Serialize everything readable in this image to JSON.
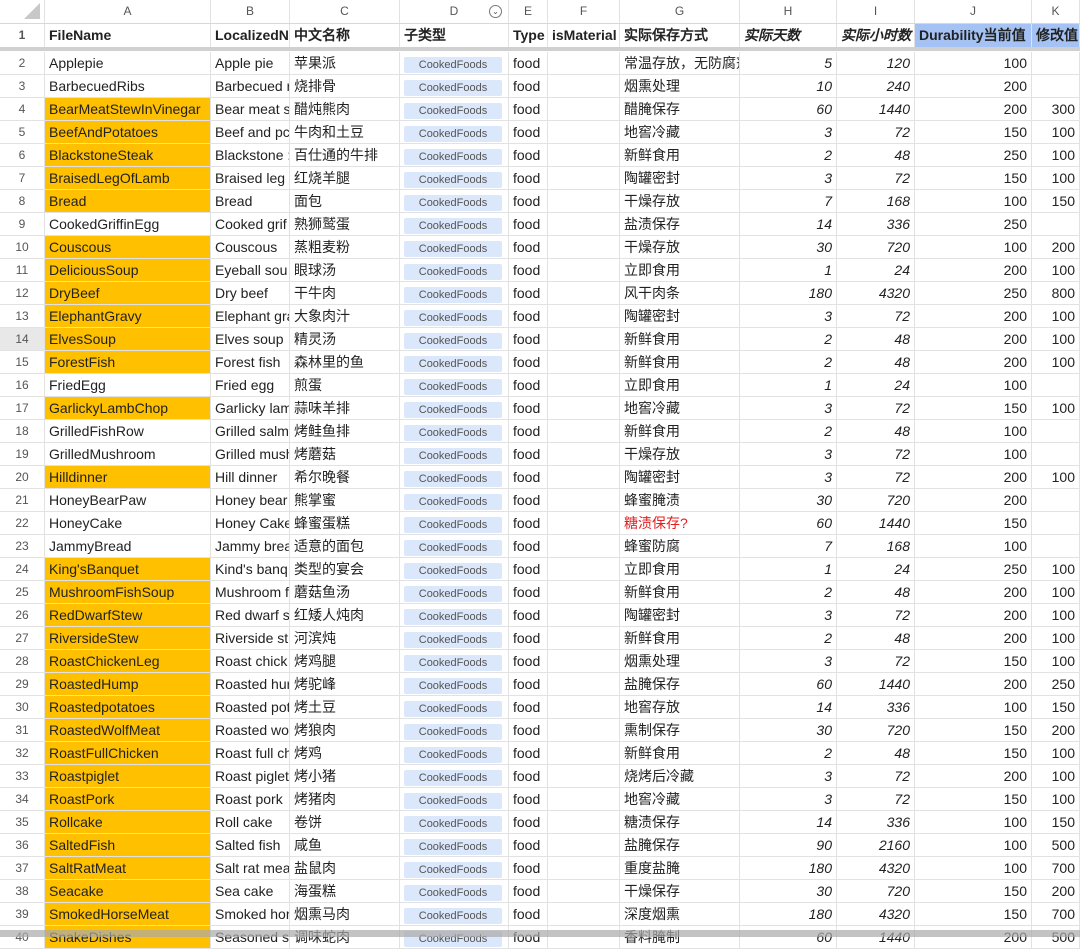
{
  "columns": [
    "A",
    "B",
    "C",
    "D",
    "E",
    "F",
    "G",
    "H",
    "I",
    "J",
    "K"
  ],
  "header": {
    "row": "1",
    "FileName": "FileName",
    "LocalizedName": "LocalizedN",
    "cn": "中文名称",
    "subtype": "子类型",
    "type": "Type",
    "isMaterial": "isMaterial",
    "storage": "实际保存方式",
    "days": "实际天数",
    "hours": "实际小时数",
    "durability": "Durability当前值",
    "modified": "修改值"
  },
  "colors": {
    "highlight": "#ffc000",
    "header_blue": "#a4c2f4",
    "chip": "#dbe7fb",
    "warn": "#e02020"
  },
  "rows": [
    {
      "n": "2",
      "a": "Applepie",
      "b": "Apple pie",
      "c": "苹果派",
      "d": "CookedFoods",
      "e": "food",
      "g": "常温存放，无防腐剂",
      "h": "5",
      "i": "120",
      "j": "100",
      "k": "",
      "hl": false
    },
    {
      "n": "3",
      "a": "BarbecuedRibs",
      "b": "Barbecued r",
      "c": "烧排骨",
      "d": "CookedFoods",
      "e": "food",
      "g": "烟熏处理",
      "h": "10",
      "i": "240",
      "j": "200",
      "k": "",
      "hl": false
    },
    {
      "n": "4",
      "a": "BearMeatStewInVinegar",
      "b": "Bear meat s",
      "c": "醋炖熊肉",
      "d": "CookedFoods",
      "e": "food",
      "g": "醋腌保存",
      "h": "60",
      "i": "1440",
      "j": "200",
      "k": "300",
      "hl": true
    },
    {
      "n": "5",
      "a": "BeefAndPotatoes",
      "b": "Beef and pc",
      "c": "牛肉和土豆",
      "d": "CookedFoods",
      "e": "food",
      "g": "地窖冷藏",
      "h": "3",
      "i": "72",
      "j": "150",
      "k": "100",
      "hl": true
    },
    {
      "n": "6",
      "a": "BlackstoneSteak",
      "b": "Blackstone :",
      "c": "百仕通的牛排",
      "d": "CookedFoods",
      "e": "food",
      "g": "新鲜食用",
      "h": "2",
      "i": "48",
      "j": "250",
      "k": "100",
      "hl": true
    },
    {
      "n": "7",
      "a": "BraisedLegOfLamb",
      "b": "Braised leg",
      "c": "红烧羊腿",
      "d": "CookedFoods",
      "e": "food",
      "g": "陶罐密封",
      "h": "3",
      "i": "72",
      "j": "150",
      "k": "100",
      "hl": true
    },
    {
      "n": "8",
      "a": "Bread",
      "b": "Bread",
      "c": "面包",
      "d": "CookedFoods",
      "e": "food",
      "g": "干燥存放",
      "h": "7",
      "i": "168",
      "j": "100",
      "k": "150",
      "hl": true
    },
    {
      "n": "9",
      "a": "CookedGriffinEgg",
      "b": "Cooked grif",
      "c": "熟狮鹫蛋",
      "d": "CookedFoods",
      "e": "food",
      "g": "盐渍保存",
      "h": "14",
      "i": "336",
      "j": "250",
      "k": "",
      "hl": false
    },
    {
      "n": "10",
      "a": "Couscous",
      "b": "Couscous",
      "c": "蒸粗麦粉",
      "d": "CookedFoods",
      "e": "food",
      "g": "干燥存放",
      "h": "30",
      "i": "720",
      "j": "100",
      "k": "200",
      "hl": true
    },
    {
      "n": "11",
      "a": "DeliciousSoup",
      "b": "Eyeball sou",
      "c": "眼球汤",
      "d": "CookedFoods",
      "e": "food",
      "g": "立即食用",
      "h": "1",
      "i": "24",
      "j": "200",
      "k": "100",
      "hl": true
    },
    {
      "n": "12",
      "a": "DryBeef",
      "b": "Dry beef",
      "c": "干牛肉",
      "d": "CookedFoods",
      "e": "food",
      "g": "风干肉条",
      "h": "180",
      "i": "4320",
      "j": "250",
      "k": "800",
      "hl": true
    },
    {
      "n": "13",
      "a": "ElephantGravy",
      "b": "Elephant gra",
      "c": "大象肉汁",
      "d": "CookedFoods",
      "e": "food",
      "g": "陶罐密封",
      "h": "3",
      "i": "72",
      "j": "200",
      "k": "100",
      "hl": true
    },
    {
      "n": "14",
      "a": "ElvesSoup",
      "b": "Elves soup",
      "c": "精灵汤",
      "d": "CookedFoods",
      "e": "food",
      "g": "新鲜食用",
      "h": "2",
      "i": "48",
      "j": "200",
      "k": "100",
      "hl": true
    },
    {
      "n": "15",
      "a": "ForestFish",
      "b": "Forest fish",
      "c": "森林里的鱼",
      "d": "CookedFoods",
      "e": "food",
      "g": "新鲜食用",
      "h": "2",
      "i": "48",
      "j": "200",
      "k": "100",
      "hl": true
    },
    {
      "n": "16",
      "a": "FriedEgg",
      "b": "Fried egg",
      "c": "煎蛋",
      "d": "CookedFoods",
      "e": "food",
      "g": "立即食用",
      "h": "1",
      "i": "24",
      "j": "100",
      "k": "",
      "hl": false
    },
    {
      "n": "17",
      "a": "GarlickyLambChop",
      "b": "Garlicky lam",
      "c": "蒜味羊排",
      "d": "CookedFoods",
      "e": "food",
      "g": "地窖冷藏",
      "h": "3",
      "i": "72",
      "j": "150",
      "k": "100",
      "hl": true
    },
    {
      "n": "18",
      "a": "GrilledFishRow",
      "b": "Grilled salm",
      "c": "烤鲑鱼排",
      "d": "CookedFoods",
      "e": "food",
      "g": "新鲜食用",
      "h": "2",
      "i": "48",
      "j": "100",
      "k": "",
      "hl": false
    },
    {
      "n": "19",
      "a": "GrilledMushroom",
      "b": "Grilled mush",
      "c": "烤蘑菇",
      "d": "CookedFoods",
      "e": "food",
      "g": "干燥存放",
      "h": "3",
      "i": "72",
      "j": "100",
      "k": "",
      "hl": false
    },
    {
      "n": "20",
      "a": "Hilldinner",
      "b": "Hill dinner",
      "c": "希尔晚餐",
      "d": "CookedFoods",
      "e": "food",
      "g": "陶罐密封",
      "h": "3",
      "i": "72",
      "j": "200",
      "k": "100",
      "hl": true
    },
    {
      "n": "21",
      "a": "HoneyBearPaw",
      "b": "Honey bear",
      "c": "熊掌蜜",
      "d": "CookedFoods",
      "e": "food",
      "g": "蜂蜜腌渍",
      "h": "30",
      "i": "720",
      "j": "200",
      "k": "",
      "hl": false
    },
    {
      "n": "22",
      "a": "HoneyCake",
      "b": "Honey Cake",
      "c": "蜂蜜蛋糕",
      "d": "CookedFoods",
      "e": "food",
      "g": "糖渍保存?",
      "h": "60",
      "i": "1440",
      "j": "150",
      "k": "",
      "hl": false,
      "warn": true
    },
    {
      "n": "23",
      "a": "JammyBread",
      "b": "Jammy brea",
      "c": "适意的面包",
      "d": "CookedFoods",
      "e": "food",
      "g": "蜂蜜防腐",
      "h": "7",
      "i": "168",
      "j": "100",
      "k": "",
      "hl": false
    },
    {
      "n": "24",
      "a": "King'sBanquet",
      "b": "Kind's banq",
      "c": "类型的宴会",
      "d": "CookedFoods",
      "e": "food",
      "g": "立即食用",
      "h": "1",
      "i": "24",
      "j": "250",
      "k": "100",
      "hl": true
    },
    {
      "n": "25",
      "a": "MushroomFishSoup",
      "b": "Mushroom f",
      "c": "蘑菇鱼汤",
      "d": "CookedFoods",
      "e": "food",
      "g": "新鲜食用",
      "h": "2",
      "i": "48",
      "j": "200",
      "k": "100",
      "hl": true
    },
    {
      "n": "26",
      "a": "RedDwarfStew",
      "b": "Red dwarf s",
      "c": "红矮人炖肉",
      "d": "CookedFoods",
      "e": "food",
      "g": "陶罐密封",
      "h": "3",
      "i": "72",
      "j": "200",
      "k": "100",
      "hl": true
    },
    {
      "n": "27",
      "a": "RiversideStew",
      "b": "Riverside st",
      "c": "河滨炖",
      "d": "CookedFoods",
      "e": "food",
      "g": "新鲜食用",
      "h": "2",
      "i": "48",
      "j": "200",
      "k": "100",
      "hl": true
    },
    {
      "n": "28",
      "a": "RoastChickenLeg",
      "b": "Roast chick",
      "c": "烤鸡腿",
      "d": "CookedFoods",
      "e": "food",
      "g": "烟熏处理",
      "h": "3",
      "i": "72",
      "j": "150",
      "k": "100",
      "hl": true
    },
    {
      "n": "29",
      "a": "RoastedHump",
      "b": "Roasted hur",
      "c": "烤驼峰",
      "d": "CookedFoods",
      "e": "food",
      "g": "盐腌保存",
      "h": "60",
      "i": "1440",
      "j": "200",
      "k": "250",
      "hl": true
    },
    {
      "n": "30",
      "a": "Roastedpotatoes",
      "b": "Roasted pot",
      "c": "烤土豆",
      "d": "CookedFoods",
      "e": "food",
      "g": "地窖存放",
      "h": "14",
      "i": "336",
      "j": "100",
      "k": "150",
      "hl": true
    },
    {
      "n": "31",
      "a": "RoastedWolfMeat",
      "b": "Roasted wo",
      "c": "烤狼肉",
      "d": "CookedFoods",
      "e": "food",
      "g": "熏制保存",
      "h": "30",
      "i": "720",
      "j": "150",
      "k": "200",
      "hl": true
    },
    {
      "n": "32",
      "a": "RoastFullChicken",
      "b": "Roast full ch",
      "c": "烤鸡",
      "d": "CookedFoods",
      "e": "food",
      "g": "新鲜食用",
      "h": "2",
      "i": "48",
      "j": "150",
      "k": "100",
      "hl": true
    },
    {
      "n": "33",
      "a": "Roastpiglet",
      "b": "Roast piglet",
      "c": "烤小猪",
      "d": "CookedFoods",
      "e": "food",
      "g": "烧烤后冷藏",
      "h": "3",
      "i": "72",
      "j": "200",
      "k": "100",
      "hl": true
    },
    {
      "n": "34",
      "a": "RoastPork",
      "b": "Roast pork",
      "c": "烤猪肉",
      "d": "CookedFoods",
      "e": "food",
      "g": "地窖冷藏",
      "h": "3",
      "i": "72",
      "j": "150",
      "k": "100",
      "hl": true
    },
    {
      "n": "35",
      "a": "Rollcake",
      "b": "Roll cake",
      "c": "卷饼",
      "d": "CookedFoods",
      "e": "food",
      "g": "糖渍保存",
      "h": "14",
      "i": "336",
      "j": "100",
      "k": "150",
      "hl": true
    },
    {
      "n": "36",
      "a": "SaltedFish",
      "b": "Salted fish",
      "c": "咸鱼",
      "d": "CookedFoods",
      "e": "food",
      "g": "盐腌保存",
      "h": "90",
      "i": "2160",
      "j": "100",
      "k": "500",
      "hl": true
    },
    {
      "n": "37",
      "a": "SaltRatMeat",
      "b": "Salt rat mea",
      "c": "盐鼠肉",
      "d": "CookedFoods",
      "e": "food",
      "g": "重度盐腌",
      "h": "180",
      "i": "4320",
      "j": "100",
      "k": "700",
      "hl": true
    },
    {
      "n": "38",
      "a": "Seacake",
      "b": "Sea cake",
      "c": "海蛋糕",
      "d": "CookedFoods",
      "e": "food",
      "g": "干燥保存",
      "h": "30",
      "i": "720",
      "j": "150",
      "k": "200",
      "hl": true
    },
    {
      "n": "39",
      "a": "SmokedHorseMeat",
      "b": "Smoked hor",
      "c": "烟熏马肉",
      "d": "CookedFoods",
      "e": "food",
      "g": "深度烟熏",
      "h": "180",
      "i": "4320",
      "j": "150",
      "k": "700",
      "hl": true
    },
    {
      "n": "40",
      "a": "SnakeDishes",
      "b": "Seasoned s",
      "c": "调味蛇肉",
      "d": "CookedFoods",
      "e": "food",
      "g": "香料腌制",
      "h": "60",
      "i": "1440",
      "j": "200",
      "k": "500",
      "hl": true
    }
  ]
}
